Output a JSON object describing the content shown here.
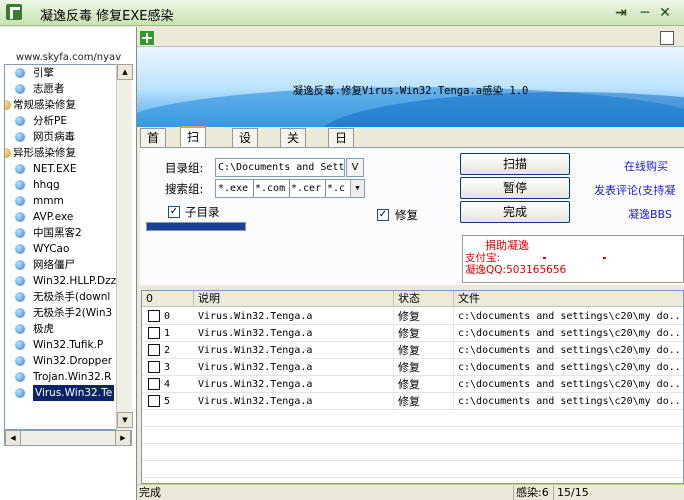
{
  "window": {
    "title": "凝逸反毒 修复EXE感染",
    "controls": [
      "⇥",
      "─",
      "✕"
    ]
  },
  "left": {
    "site": "www.skyfa.com/nyav",
    "tree": [
      {
        "label": "引擎",
        "level": 1
      },
      {
        "label": "志愿者",
        "level": 1
      },
      {
        "label": "常规感染修复",
        "level": 0
      },
      {
        "label": "分析PE",
        "level": 1
      },
      {
        "label": "网页病毒",
        "level": 1
      },
      {
        "label": "异形感染修复",
        "level": 0
      },
      {
        "label": "NET.EXE",
        "level": 1
      },
      {
        "label": "hhqg",
        "level": 1
      },
      {
        "label": "mmm",
        "level": 1
      },
      {
        "label": "AVP.exe",
        "level": 1
      },
      {
        "label": "中国黑客2",
        "level": 1
      },
      {
        "label": "WYCao",
        "level": 1
      },
      {
        "label": "网络僵尸",
        "level": 1
      },
      {
        "label": "Win32.HLLP.Dzz",
        "level": 1
      },
      {
        "label": "无极杀手(downl",
        "level": 1
      },
      {
        "label": "无极杀手2(Win3",
        "level": 1
      },
      {
        "label": "极虎",
        "level": 1
      },
      {
        "label": "Win32.Tufik.P",
        "level": 1
      },
      {
        "label": "Win32.Dropper",
        "level": 1
      },
      {
        "label": "Trojan.Win32.R",
        "level": 1
      },
      {
        "label": "Virus.Win32.Te",
        "level": 1,
        "selected": true
      }
    ]
  },
  "banner": {
    "title": "凝逸反毒.修复Virus.Win32.Tenga.a感染 1.0"
  },
  "tabs": [
    "首页",
    "扫描",
    "设置",
    "关于",
    "日记"
  ],
  "scan": {
    "dir_label": "目录组:",
    "dir_value": "C:\\Documents and Sett",
    "dir_button": "V",
    "search_label": "搜索组:",
    "search_exts": [
      "*.exe",
      "*.com",
      "*.cer",
      "*.c"
    ],
    "subdir_label": "子目录",
    "subdir_checked": true,
    "repair_label": "修复",
    "repair_checked": true,
    "progress": 1.0,
    "buttons": {
      "scan": "扫描",
      "pause": "暂停",
      "done": "完成"
    },
    "links": [
      "在线购买",
      "发表评论(支持凝",
      "凝逸BBS"
    ]
  },
  "notice": {
    "title": "捐助凝逸",
    "alipay": "支付宝:",
    "qq": "凝逸QQ:503165656"
  },
  "list": {
    "columns": [
      "0",
      "说明",
      "状态",
      "文件"
    ],
    "rows": [
      {
        "idx": "0",
        "desc": "Virus.Win32.Tenga.a",
        "status": "修复",
        "file": "c:\\documents and settings\\c20\\my do..."
      },
      {
        "idx": "1",
        "desc": "Virus.Win32.Tenga.a",
        "status": "修复",
        "file": "c:\\documents and settings\\c20\\my do..."
      },
      {
        "idx": "2",
        "desc": "Virus.Win32.Tenga.a",
        "status": "修复",
        "file": "c:\\documents and settings\\c20\\my do..."
      },
      {
        "idx": "3",
        "desc": "Virus.Win32.Tenga.a",
        "status": "修复",
        "file": "c:\\documents and settings\\c20\\my do..."
      },
      {
        "idx": "4",
        "desc": "Virus.Win32.Tenga.a",
        "status": "修复",
        "file": "c:\\documents and settings\\c20\\my do..."
      },
      {
        "idx": "5",
        "desc": "Virus.Win32.Tenga.a",
        "status": "修复",
        "file": "c:\\documents and settings\\c20\\my do..."
      }
    ]
  },
  "status": {
    "left": "完成",
    "infected": "感染:6",
    "count": "15/15"
  }
}
